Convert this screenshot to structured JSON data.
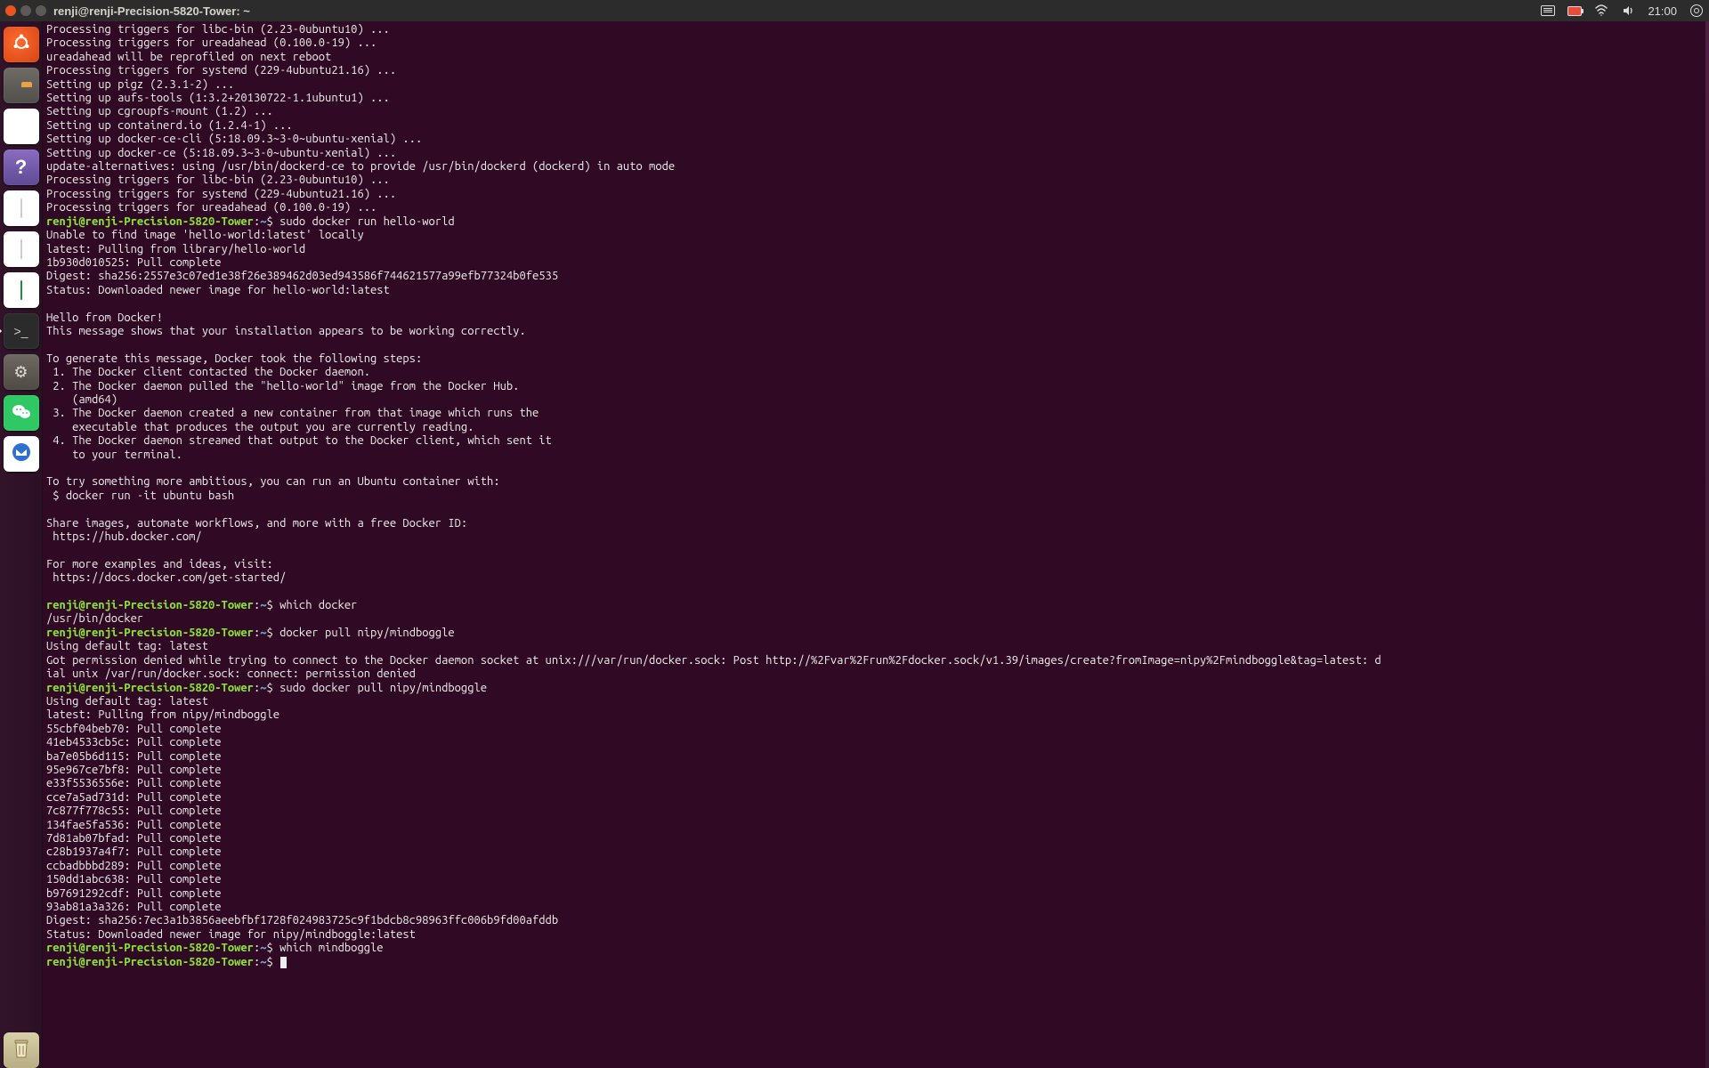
{
  "menubar": {
    "title": "renji@renji-Precision-5820-Tower: ~",
    "time": "21:00"
  },
  "launcher": {
    "items": [
      {
        "name": "ubuntu-dash",
        "glyph": "◌"
      },
      {
        "name": "files",
        "glyph": ""
      },
      {
        "name": "chromium",
        "glyph": ""
      },
      {
        "name": "help",
        "glyph": "?"
      },
      {
        "name": "libreoffice-writer",
        "glyph": ""
      },
      {
        "name": "libreoffice-impress",
        "glyph": ""
      },
      {
        "name": "libreoffice-calc",
        "glyph": ""
      },
      {
        "name": "terminal",
        "glyph": ">_",
        "active": true
      },
      {
        "name": "system-settings",
        "glyph": "⚙"
      },
      {
        "name": "wechat",
        "glyph": "✉"
      },
      {
        "name": "thunderbird",
        "glyph": "✉"
      }
    ],
    "trash": {
      "name": "trash",
      "glyph": "🗑"
    }
  },
  "prompt": {
    "userhost": "renji@renji-Precision-5820-Tower",
    "sep": ":",
    "path": "~",
    "sigil": "$"
  },
  "cmds": {
    "c1": "sudo docker run hello-world",
    "c2": "which docker",
    "c3": "docker pull nipy/mindboggle",
    "c4": "sudo docker pull nipy/mindboggle",
    "c5": "which mindboggle"
  },
  "out": {
    "block0": "Processing triggers for libc-bin (2.23-0ubuntu10) ...\nProcessing triggers for ureadahead (0.100.0-19) ...\nureadahead will be reprofiled on next reboot\nProcessing triggers for systemd (229-4ubuntu21.16) ...\nSetting up pigz (2.3.1-2) ...\nSetting up aufs-tools (1:3.2+20130722-1.1ubuntu1) ...\nSetting up cgroupfs-mount (1.2) ...\nSetting up containerd.io (1.2.4-1) ...\nSetting up docker-ce-cli (5:18.09.3~3-0~ubuntu-xenial) ...\nSetting up docker-ce (5:18.09.3~3-0~ubuntu-xenial) ...\nupdate-alternatives: using /usr/bin/dockerd-ce to provide /usr/bin/dockerd (dockerd) in auto mode\nProcessing triggers for libc-bin (2.23-0ubuntu10) ...\nProcessing triggers for systemd (229-4ubuntu21.16) ...\nProcessing triggers for ureadahead (0.100.0-19) ...",
    "block1": "Unable to find image 'hello-world:latest' locally\nlatest: Pulling from library/hello-world\n1b930d010525: Pull complete\nDigest: sha256:2557e3c07ed1e38f26e389462d03ed943586f744621577a99efb77324b0fe535\nStatus: Downloaded newer image for hello-world:latest\n\nHello from Docker!\nThis message shows that your installation appears to be working correctly.\n\nTo generate this message, Docker took the following steps:\n 1. The Docker client contacted the Docker daemon.\n 2. The Docker daemon pulled the \"hello-world\" image from the Docker Hub.\n    (amd64)\n 3. The Docker daemon created a new container from that image which runs the\n    executable that produces the output you are currently reading.\n 4. The Docker daemon streamed that output to the Docker client, which sent it\n    to your terminal.\n\nTo try something more ambitious, you can run an Ubuntu container with:\n $ docker run -it ubuntu bash\n\nShare images, automate workflows, and more with a free Docker ID:\n https://hub.docker.com/\n\nFor more examples and ideas, visit:\n https://docs.docker.com/get-started/\n",
    "block2": "/usr/bin/docker",
    "block3": "Using default tag: latest\nGot permission denied while trying to connect to the Docker daemon socket at unix:///var/run/docker.sock: Post http://%2Fvar%2Frun%2Fdocker.sock/v1.39/images/create?fromImage=nipy%2Fmindboggle&tag=latest: d\nial unix /var/run/docker.sock: connect: permission denied",
    "block4": "Using default tag: latest\nlatest: Pulling from nipy/mindboggle\n55cbf04beb70: Pull complete\n41eb4533cb5c: Pull complete\nba7e05b6d115: Pull complete\n95e967ce7bf8: Pull complete\ne33f5536556e: Pull complete\ncce7a5ad731d: Pull complete\n7c877f778c55: Pull complete\n134fae5fa536: Pull complete\n7d81ab07bfad: Pull complete\nc28b1937a4f7: Pull complete\nccbadbbbd289: Pull complete\n150dd1abc638: Pull complete\nb97691292cdf: Pull complete\n93ab81a3a326: Pull complete\nDigest: sha256:7ec3a1b3856aeebfbf1728f024983725c9f1bdcb8c98963ffc006b9fd00afddb\nStatus: Downloaded newer image for nipy/mindboggle:latest"
  }
}
